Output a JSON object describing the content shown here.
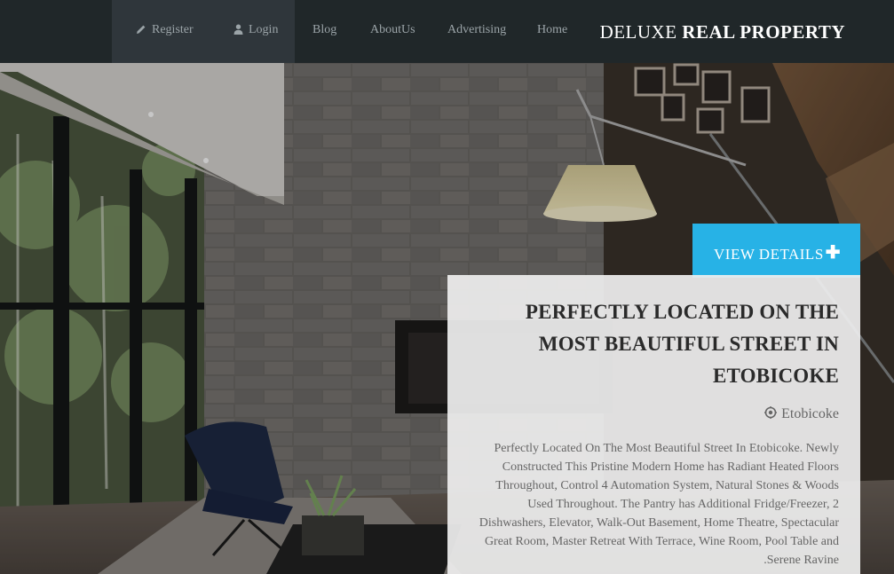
{
  "nav": {
    "brand_part1": "DELUXE",
    "brand_part2": "REAL PROPERTY",
    "links": [
      {
        "label": "Register",
        "icon": "pencil-icon"
      },
      {
        "label": "Login",
        "icon": "user-icon"
      },
      {
        "label": "Blog"
      },
      {
        "label": "AboutUs"
      },
      {
        "label": "Advertising"
      },
      {
        "label": "Home"
      }
    ]
  },
  "hero": {
    "view_details_label": "VIEW DETAILS",
    "view_details_icon": "plus-icon",
    "title": "PERFECTLY LOCATED ON THE MOST BEAUTIFUL STREET IN ETOBICOKE",
    "location_icon": "location-pin-icon",
    "location": "Etobicoke",
    "description": "Perfectly Located On The Most Beautiful Street In Etobicoke. Newly Constructed This Pristine Modern Home has Radiant Heated Floors Throughout, Control 4 Automation System, Natural Stones & Woods Used Throughout. The Pantry has Additional Fridge/Freezer, 2 Dishwashers, Elevator, Walk-Out Basement, Home Theatre, Spectacular Great Room, Master Retreat With Terrace, Wine Room, Pool Table and .Serene Ravine"
  },
  "colors": {
    "nav_bg": "#202729",
    "nav_active_bg": "#2f363b",
    "accent": "#27b2e6"
  }
}
